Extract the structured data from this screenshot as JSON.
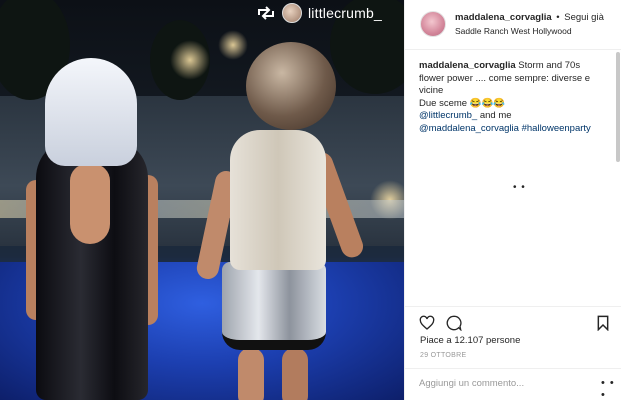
{
  "repost": {
    "username": "littlecrumb_",
    "icon": "repost-icon"
  },
  "header": {
    "username": "maddalena_corvaglia",
    "separator": "•",
    "follow_label": "Segui già",
    "location": "Saddle Ranch West Hollywood"
  },
  "caption": {
    "username": "maddalena_corvaglia",
    "text_line1": " Storm and 70s",
    "text_line2": "flower power .... come sempre: diverse e",
    "text_line3": "vicine",
    "text_line4": "Due sceme 😂😂😂",
    "mention1": "@littlecrumb_",
    "text_line5": " and me",
    "mention2": "@maddalena_corvaglia",
    "hashtag": " #halloweenparty"
  },
  "more_indicator": "• •",
  "actions": {
    "like_icon": "heart-icon",
    "comment_icon": "comment-icon",
    "save_icon": "bookmark-icon"
  },
  "likes": "Piace a 12.107 persone",
  "date": "29 OTTOBRE",
  "comment_box": {
    "placeholder": "Aggiungi un commento...",
    "options": "• • •"
  }
}
